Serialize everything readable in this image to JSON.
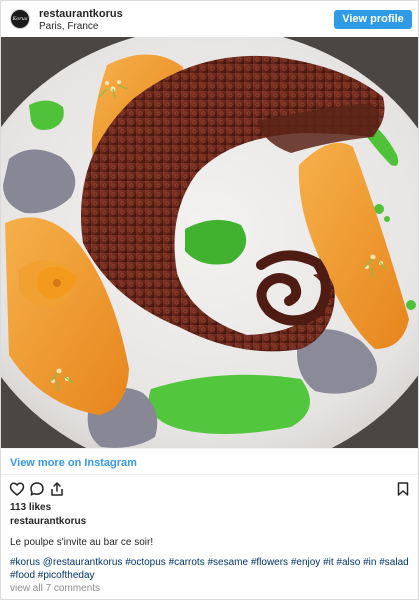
{
  "header": {
    "avatar_text": "Korus",
    "username": "restaurantkorus",
    "location": "Paris, France",
    "view_profile_label": "View profile"
  },
  "post": {
    "photo_icon": "plated-octopus-dish-image",
    "view_more_label": "View more on Instagram",
    "actions": {
      "like_icon": "heart-icon",
      "comment_icon": "comment-icon",
      "share_icon": "share-icon",
      "save_icon": "bookmark-icon"
    },
    "likes": "113 likes",
    "username": "restaurantkorus",
    "caption": "Le poulpe s'invite au bar ce soir!",
    "hashtags": "#korus @restaurantkorus #octopus #carrots #sesame #flowers #enjoy #it #also #in #salad #food #picoftheday",
    "comments_link": "view all 7 comments"
  },
  "colors": {
    "accent": "#3897f0",
    "button": "#2f9be6",
    "hashtag": "#003569",
    "muted": "#8e8e8e"
  }
}
